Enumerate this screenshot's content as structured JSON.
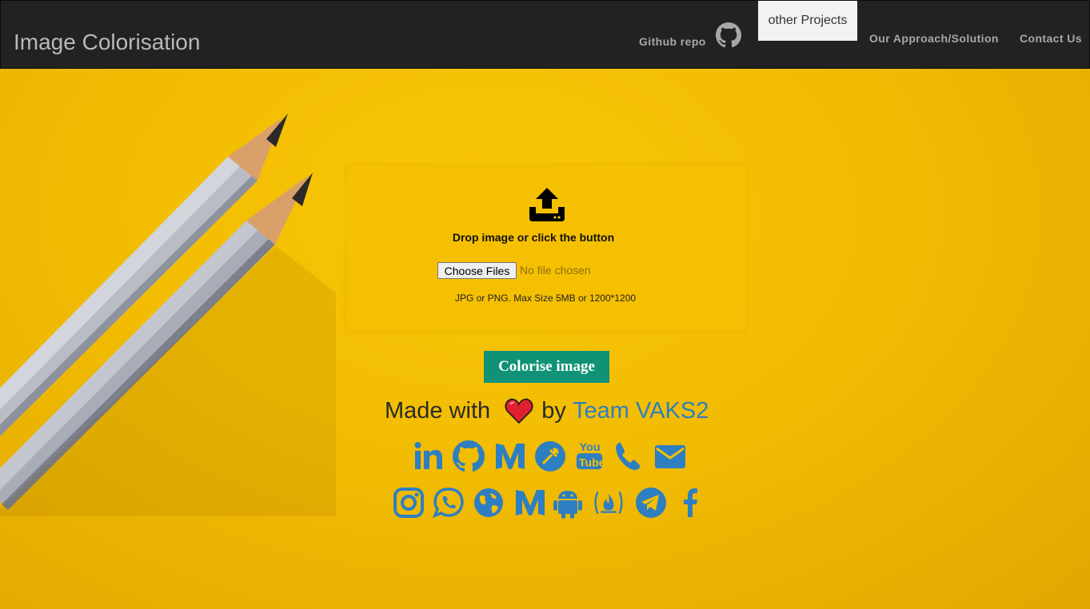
{
  "navbar": {
    "brand": "Image Colorisation",
    "github_repo": "Github repo",
    "other_projects": "other Projects",
    "approach": "Our Approach/Solution",
    "contact": "Contact Us"
  },
  "upload": {
    "icon": "upload-tray-icon",
    "drop_text": "Drop image or click the button",
    "choose_button": "Choose Files",
    "no_file": "No file chosen",
    "size_hint": "JPG or PNG. Max Size 5MB or 1200*1200"
  },
  "colorise_button": "Colorise image",
  "footer": {
    "made_with": "Made with",
    "by": "by",
    "team": "Team VAKS2",
    "social_row1": [
      "linkedin-icon",
      "github-icon",
      "medium-icon",
      "hackerrank-icon",
      "youtube-icon",
      "phone-icon",
      "email-icon"
    ],
    "social_row2": [
      "instagram-icon",
      "whatsapp-icon",
      "globe-icon",
      "medium-icon",
      "android-icon",
      "fire-icon",
      "telegram-icon",
      "facebook-icon"
    ]
  },
  "colors": {
    "navbar_bg": "#222222",
    "background": "#f1bd05",
    "accent_green": "#0f9276",
    "link_blue": "#2e7fc1"
  }
}
